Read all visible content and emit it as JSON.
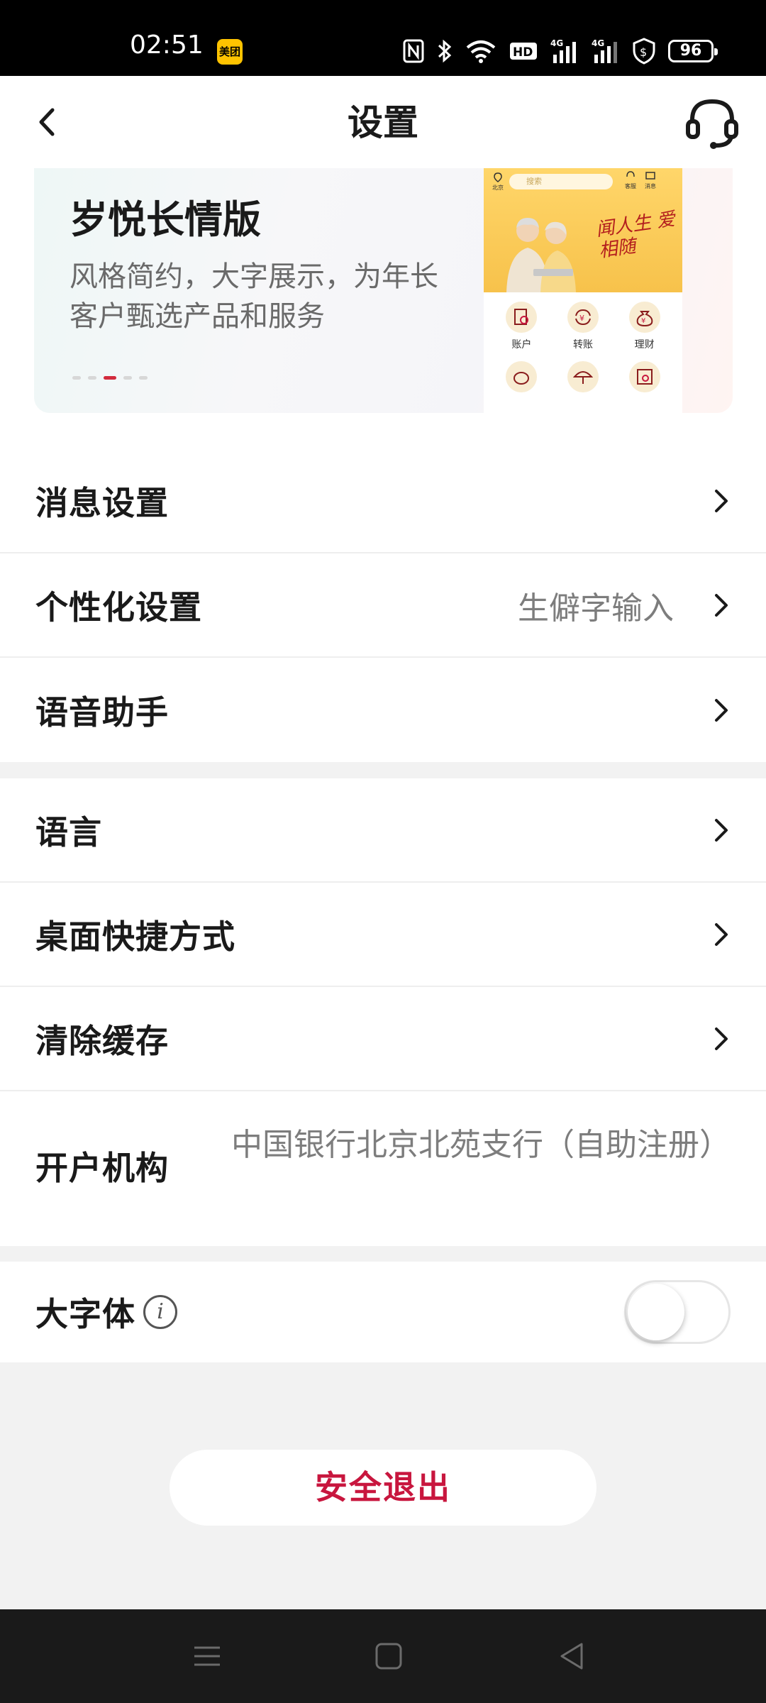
{
  "status_bar": {
    "time": "02:51",
    "app_badge": "美团",
    "network": "4G",
    "network2": "4G",
    "battery": "96",
    "hd": "HD"
  },
  "header": {
    "title": "设置",
    "icons": [
      "back-arrow-icon",
      "headset-support-icon"
    ]
  },
  "banner": {
    "title": "岁悦长情版",
    "description": "风格简约，大字展示，为年长客户甄选产品和服务",
    "dots_count": 5,
    "active_dot": 3,
    "preview": {
      "search_placeholder": "搜索",
      "location": "北京",
      "kefu": "客服",
      "message": "消息",
      "poem": "闻人生 爱相随",
      "items": [
        "账户",
        "转账",
        "理财"
      ]
    }
  },
  "section1": [
    {
      "label": "消息设置",
      "value": ""
    },
    {
      "label": "个性化设置",
      "value": "生僻字输入"
    },
    {
      "label": "语音助手",
      "value": ""
    }
  ],
  "section2": [
    {
      "label": "语言",
      "value": ""
    },
    {
      "label": "桌面快捷方式",
      "value": ""
    },
    {
      "label": "清除缓存",
      "value": ""
    }
  ],
  "org": {
    "label": "开户机构",
    "value": "中国银行北京北苑支行（自助注册）"
  },
  "large_font": {
    "label": "大字体",
    "info": "i",
    "enabled": false
  },
  "logout": {
    "label": "安全退出"
  },
  "colors": {
    "accent": "#c8163e",
    "background": "#f2f2f2"
  }
}
